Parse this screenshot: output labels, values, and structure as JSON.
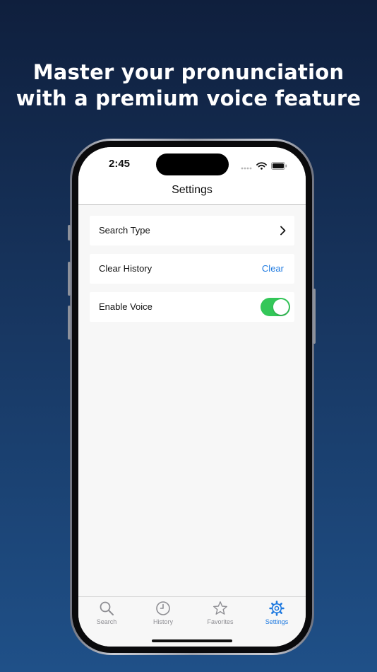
{
  "headline": {
    "line1": "Master your pronunciation",
    "line2": "with a premium voice feature"
  },
  "status_bar": {
    "time": "2:45",
    "icons": [
      "signal-dots-icon",
      "wifi-icon",
      "battery-icon"
    ]
  },
  "nav": {
    "title": "Settings"
  },
  "settings": {
    "rows": [
      {
        "label": "Search Type",
        "accessory": "chevron-right-icon"
      },
      {
        "label": "Clear History",
        "action": "Clear"
      },
      {
        "label": "Enable Voice",
        "toggle_on": true
      }
    ]
  },
  "tabs": [
    {
      "label": "Search",
      "icon": "search-icon",
      "active": false
    },
    {
      "label": "History",
      "icon": "clock-icon",
      "active": false
    },
    {
      "label": "Favorites",
      "icon": "star-icon",
      "active": false
    },
    {
      "label": "Settings",
      "icon": "gear-icon",
      "active": true
    }
  ],
  "colors": {
    "accent": "#1f7ae0",
    "toggle_on": "#34c759",
    "inactive_tab": "#8e8e93",
    "background_top": "#0f1f3d",
    "background_bottom": "#1f5088"
  }
}
